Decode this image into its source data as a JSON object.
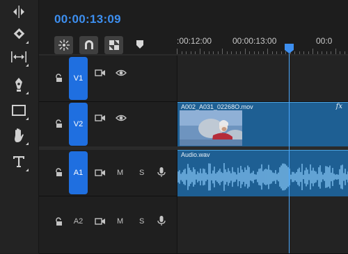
{
  "toolbar": {
    "tools": [
      {
        "name": "track-select-icon"
      },
      {
        "name": "ripple-edit-icon"
      },
      {
        "name": "slip-icon"
      },
      {
        "name": "pen-icon"
      },
      {
        "name": "rectangle-icon"
      },
      {
        "name": "hand-icon"
      },
      {
        "name": "type-icon"
      }
    ]
  },
  "timeline": {
    "timecode": "00:00:13:09",
    "ruler_labels": [
      ":00:12:00",
      "00:00:13:00",
      "00:0"
    ],
    "playhead_color": "#4aa8ff"
  },
  "tracks": {
    "v1": {
      "label": "V1"
    },
    "v2": {
      "label": "V2"
    },
    "a1": {
      "label": "A1",
      "mute": "M",
      "solo": "S"
    },
    "a2": {
      "label": "A2",
      "mute": "M",
      "solo": "S"
    }
  },
  "clips": {
    "video": {
      "name": "A002_A031_02268O.mov",
      "fx": "fx"
    },
    "audio": {
      "name": "Audio.wav"
    }
  },
  "colors": {
    "accent": "#3d8ff0",
    "track_target": "#1f6fe0",
    "clip": "#1e5f93"
  }
}
